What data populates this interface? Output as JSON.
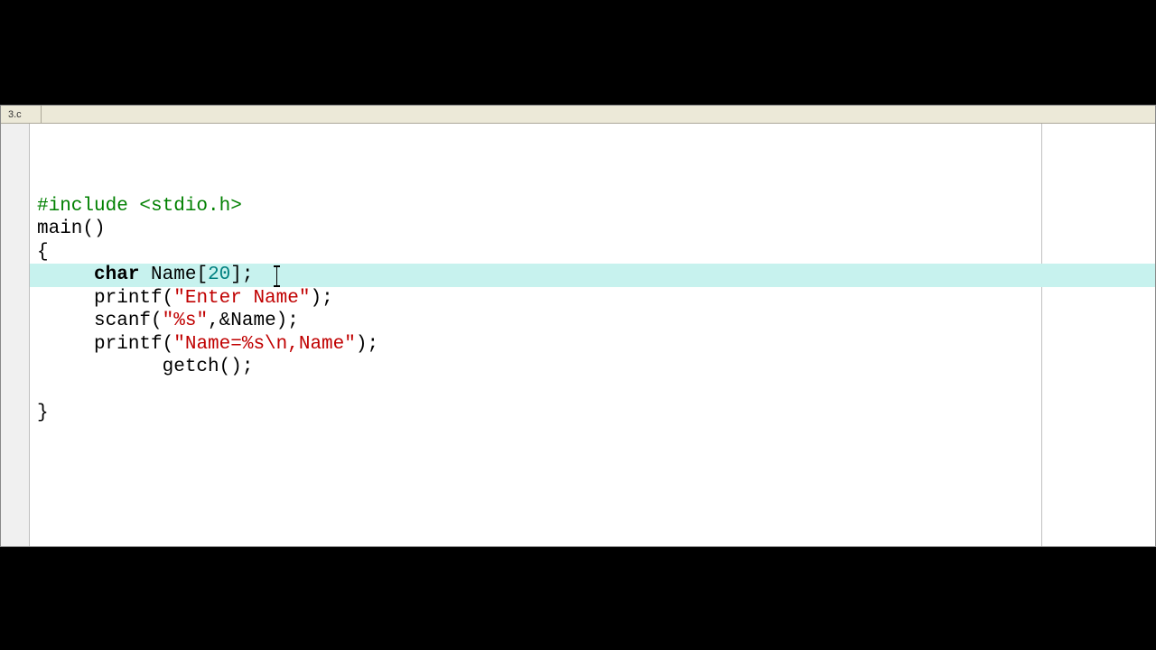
{
  "tab": {
    "label": "3.c"
  },
  "code": {
    "line1": {
      "include": "#include <stdio.h>"
    },
    "line2": {
      "text": "main()"
    },
    "line3": {
      "text": "{"
    },
    "line4": {
      "indent": "     ",
      "kw": "char",
      "rest1": " Name[",
      "num": "20",
      "rest2": "];  "
    },
    "line5": {
      "indent": "     ",
      "fn": "printf(",
      "str": "\"Enter Name\"",
      "rest": ");"
    },
    "line6": {
      "indent": "     ",
      "fn": "scanf(",
      "str": "\"%s\"",
      "rest": ",&Name);"
    },
    "line7": {
      "indent": "     ",
      "fn": "printf(",
      "str": "\"Name=%s\\n,Name\"",
      "rest": ");"
    },
    "line8": {
      "indent": "           ",
      "text": "getch();"
    },
    "line9": {
      "text": ""
    },
    "line10": {
      "text": "}"
    }
  }
}
